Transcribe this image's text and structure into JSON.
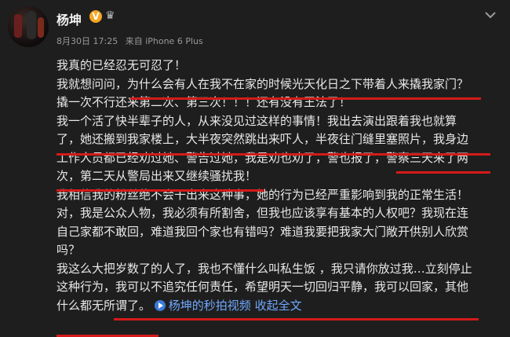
{
  "header": {
    "name": "杨坤",
    "verified_badge": "V",
    "meta": {
      "date": "8月30日 17:25",
      "source": "来自 iPhone 6 Plus"
    }
  },
  "post": {
    "lines": [
      "我真的已经忍无可忍了！",
      "我就想问问，为什么会有人在我不在家的时候光天化日之下带着人来撬我家门？",
      "撬一次不行还来第二次、第三次！！！还有没有王法了！",
      "我一个活了快半辈子的人，从来没见过这样的事情！我出去演出跟着我也就算",
      "了，她还搬到我家楼上，大半夜突然跳出来吓人，半夜往门缝里塞照片，我身边",
      "工作人员都已经劝过她、警告过她，我是劝也劝了，警也报了，警察三天来了两",
      "次，第二天从警局出来又继续骚扰我！",
      "我相信我的粉丝绝不会干出来这种事，她的行为已经严重影响到我的正常生活！",
      "对，我是公众人物，我必须有所割舍，但我也应该享有基本的人权吧？我现在连",
      "自己家都不敢回，难道我回个家也有错吗？难道我要把我家大门敞开供别人欣赏",
      "吗？",
      "我这么大把岁数了的人了，我也不懂什么叫私生饭 ，我只请你放过我…立刻停止",
      "这种行为，我可以不追究任何责任，希望明天一切回归平静，我可以回家，其他",
      "什么都无所谓了。"
    ],
    "video_link": "杨坤的秒拍视频",
    "collapse_link": "收起全文"
  },
  "colors": {
    "underline": "#d41a1a",
    "link": "#6fa8ff",
    "verified": "#f5a623"
  }
}
